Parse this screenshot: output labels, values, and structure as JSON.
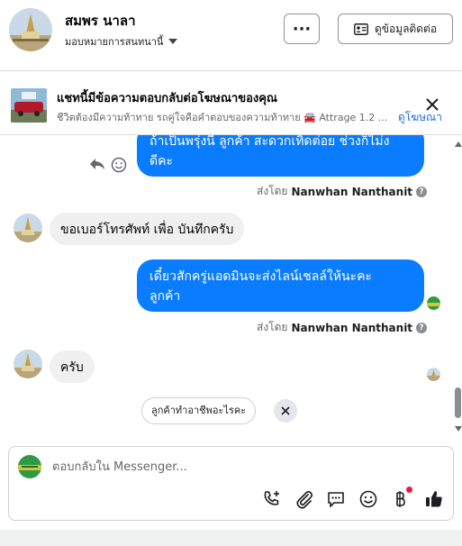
{
  "header": {
    "name": "สมพร นาลา",
    "assign_label": "มอบหมายการสนทนานี้",
    "more_label": "···",
    "contact_label": "ดูข้อมูลติดต่อ",
    "more_icon": "more-horizontal-icon",
    "contact_icon": "contact-card-icon"
  },
  "ad_banner": {
    "title": "แชทนี้มีข้อความตอบกลับต่อโฆษณาของคุณ",
    "subtitle": "ชีวิตต้องมีความท้าทาย รถคู่ใจคือคำตอบของความท้าทาย 🚘 Attrage 1.2 ...",
    "link": "ดูโฆษณา"
  },
  "messages": [
    {
      "direction": "out",
      "text": "ถ้าเป็นพรุ่งนี้ ลูกค้า สะดวกเทิดต่อย ช่วงก็ไม่ง\nดีคะ",
      "sent_by_prefix": "ส่งโดย",
      "sent_by_name": "Nanwhan Nanthanit"
    },
    {
      "direction": "in",
      "text": "ขอเบอร์โทรศัพท์ เพื่อ บันทึกครับ"
    },
    {
      "direction": "out",
      "text": "เดี๋ยวสักครู่แอดมินจะส่งไลน์เชลล์ให้นะคะ\nลูกค้า",
      "sent_by_prefix": "ส่งโดย",
      "sent_by_name": "Nanwhan Nanthanit"
    },
    {
      "direction": "in",
      "text": "ครับ"
    }
  ],
  "info_glyph": "?",
  "suggestion": {
    "label": "ลูกค้าทำอาชีพอะไรคะ"
  },
  "composer": {
    "placeholder": "ตอบกลับใน Messenger...",
    "tools": [
      "call-add-icon",
      "attachment-icon",
      "chat-template-icon",
      "emoji-icon",
      "baht-payment-icon",
      "thumbs-up-icon"
    ]
  },
  "colors": {
    "accent": "#0a7cff",
    "incoming_bubble": "#f0f0f0",
    "link": "#216fdb",
    "notification": "#e41e3f"
  }
}
